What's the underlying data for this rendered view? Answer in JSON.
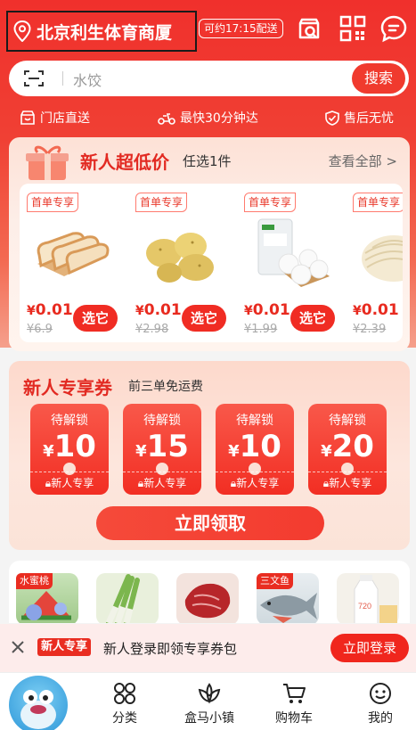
{
  "header": {
    "location": "北京利生体育商厦",
    "eta": "可约17:15配送",
    "icons": [
      "service-icon",
      "qr-scan-icon",
      "message-icon"
    ]
  },
  "search": {
    "placeholder": "水饺",
    "button": "搜索"
  },
  "guarantees": [
    "门店直送",
    "最快30分钟达",
    "售后无忧"
  ],
  "newbie_deals": {
    "title": "新人超低价",
    "subtitle": "任选1件",
    "view_all": "查看全部 >",
    "products": [
      {
        "tag": "首单专享",
        "price_symbol": "¥",
        "price": "0.01",
        "original": "¥6.9",
        "pick": "选它",
        "image": "toast-bread"
      },
      {
        "tag": "首单专享",
        "price_symbol": "¥",
        "price": "0.01",
        "original": "¥2.98",
        "pick": "选它",
        "image": "potatoes"
      },
      {
        "tag": "首单专享",
        "price_symbol": "¥",
        "price": "0.01",
        "original": "¥1.99",
        "pick": "选它",
        "image": "steamed-buns"
      },
      {
        "tag": "首单专享",
        "price_symbol": "¥",
        "price": "0.01",
        "original": "¥2.39",
        "pick": "",
        "image": "noodles"
      }
    ]
  },
  "coupons": {
    "title": "新人专享券",
    "subtitle": "前三单免运费",
    "items": [
      {
        "status": "待解锁",
        "symbol": "¥",
        "amount": "10",
        "label": "新人专享"
      },
      {
        "status": "待解锁",
        "symbol": "¥",
        "amount": "15",
        "label": "新人专享"
      },
      {
        "status": "待解锁",
        "symbol": "¥",
        "amount": "10",
        "label": "新人专享"
      },
      {
        "status": "待解锁",
        "symbol": "¥",
        "amount": "20",
        "label": "新人专享"
      }
    ],
    "claim": "立即领取"
  },
  "categories": [
    {
      "tag": "水蜜桃",
      "image": "watermelon-hydrangea"
    },
    {
      "tag": "",
      "image": "scallions"
    },
    {
      "tag": "",
      "image": "beef"
    },
    {
      "tag": "三文鱼",
      "image": "fish"
    },
    {
      "tag": "",
      "image": "milk"
    }
  ],
  "banner": {
    "tag": "新人专享",
    "text": "新人登录即领专享券包",
    "button": "立即登录"
  },
  "tabbar": [
    {
      "label": "",
      "icon": "mascot-avatar"
    },
    {
      "label": "分类",
      "icon": "category-icon"
    },
    {
      "label": "盒马小镇",
      "icon": "lotus-icon"
    },
    {
      "label": "购物车",
      "icon": "cart-icon"
    },
    {
      "label": "我的",
      "icon": "face-icon"
    }
  ],
  "colors": {
    "brand_red": "#f0302c",
    "price_red": "#e82a1f"
  }
}
